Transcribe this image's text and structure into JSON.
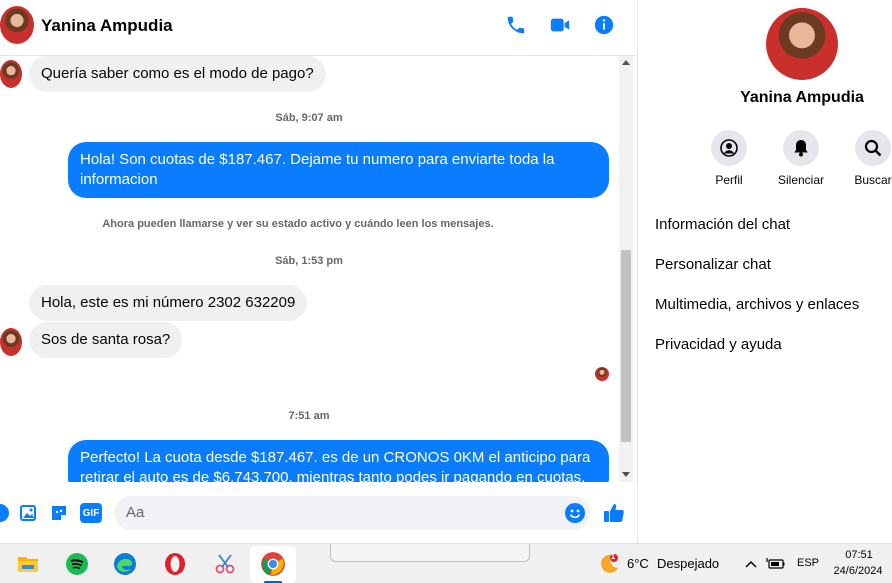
{
  "contact": {
    "name": "Yanina Ampudia"
  },
  "messages": {
    "m1": "Quería saber como es el modo de pago?",
    "t1": "Sáb, 9:07 am",
    "m2": "Hola! Son cuotas de $187.467. Dejame tu numero para enviarte toda la informacion",
    "sys": "Ahora pueden llamarse y ver su estado activo y cuándo leen los mensajes.",
    "t2": "Sáb, 1:53 pm",
    "m3": "Hola, este es mi número 2302 632209",
    "m4": "Sos de santa rosa?",
    "t3": "7:51 am",
    "m5": "Perfecto! La cuota desde $187.467. es de un CRONOS 0KM el anticipo para retirar el auto es de $6.743.700. mientras tanto podes ir pagando en cuotas."
  },
  "composer": {
    "placeholder": "Aa",
    "gif_label": "GIF"
  },
  "panel": {
    "actions": {
      "profile": "Perfil",
      "mute": "Silenciar",
      "search": "Buscar"
    },
    "menu": {
      "chat_info": "Información del chat",
      "customize": "Personalizar chat",
      "media": "Multimedia, archivos y enlaces",
      "privacy": "Privacidad y ayuda"
    }
  },
  "taskbar": {
    "weather_temp": "6°C",
    "weather_condition": "Despejado",
    "weather_badge": "1",
    "language": "ESP",
    "time": "07:51",
    "date": "24/6/2024"
  },
  "colors": {
    "accent": "#0a7cff",
    "incoming": "#f0f0f0"
  }
}
